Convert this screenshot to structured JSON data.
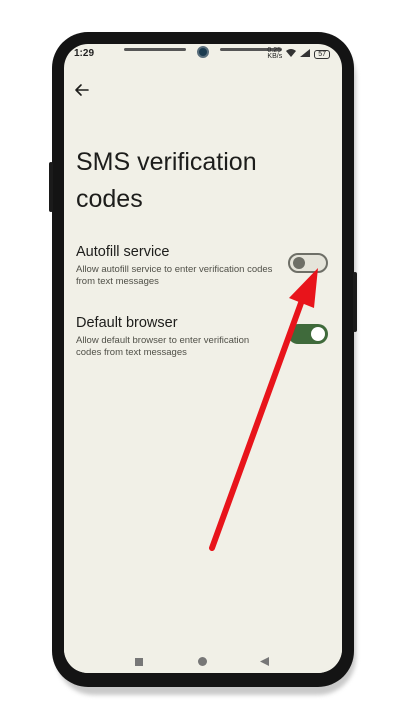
{
  "status_bar": {
    "time": "1:29",
    "speed_value": "0.25",
    "speed_unit": "KB/s",
    "battery": "57"
  },
  "page": {
    "title": "SMS verification codes"
  },
  "settings": [
    {
      "title": "Autofill service",
      "description": "Allow autofill service to enter verification codes from text messages",
      "enabled": false
    },
    {
      "title": "Default browser",
      "description": "Allow default browser to enter verification codes from text messages",
      "enabled": true
    }
  ],
  "icons": {
    "back": "arrow-left-icon",
    "nav_recent": "square-icon",
    "nav_home": "circle-icon",
    "nav_back": "triangle-icon",
    "annotation": "red-arrow-icon"
  },
  "colors": {
    "screen_background": "#f1f0e7",
    "switch_on": "#3f6a3b",
    "switch_off_outline": "#6e6f67",
    "annotation_arrow": "#e8141b"
  }
}
